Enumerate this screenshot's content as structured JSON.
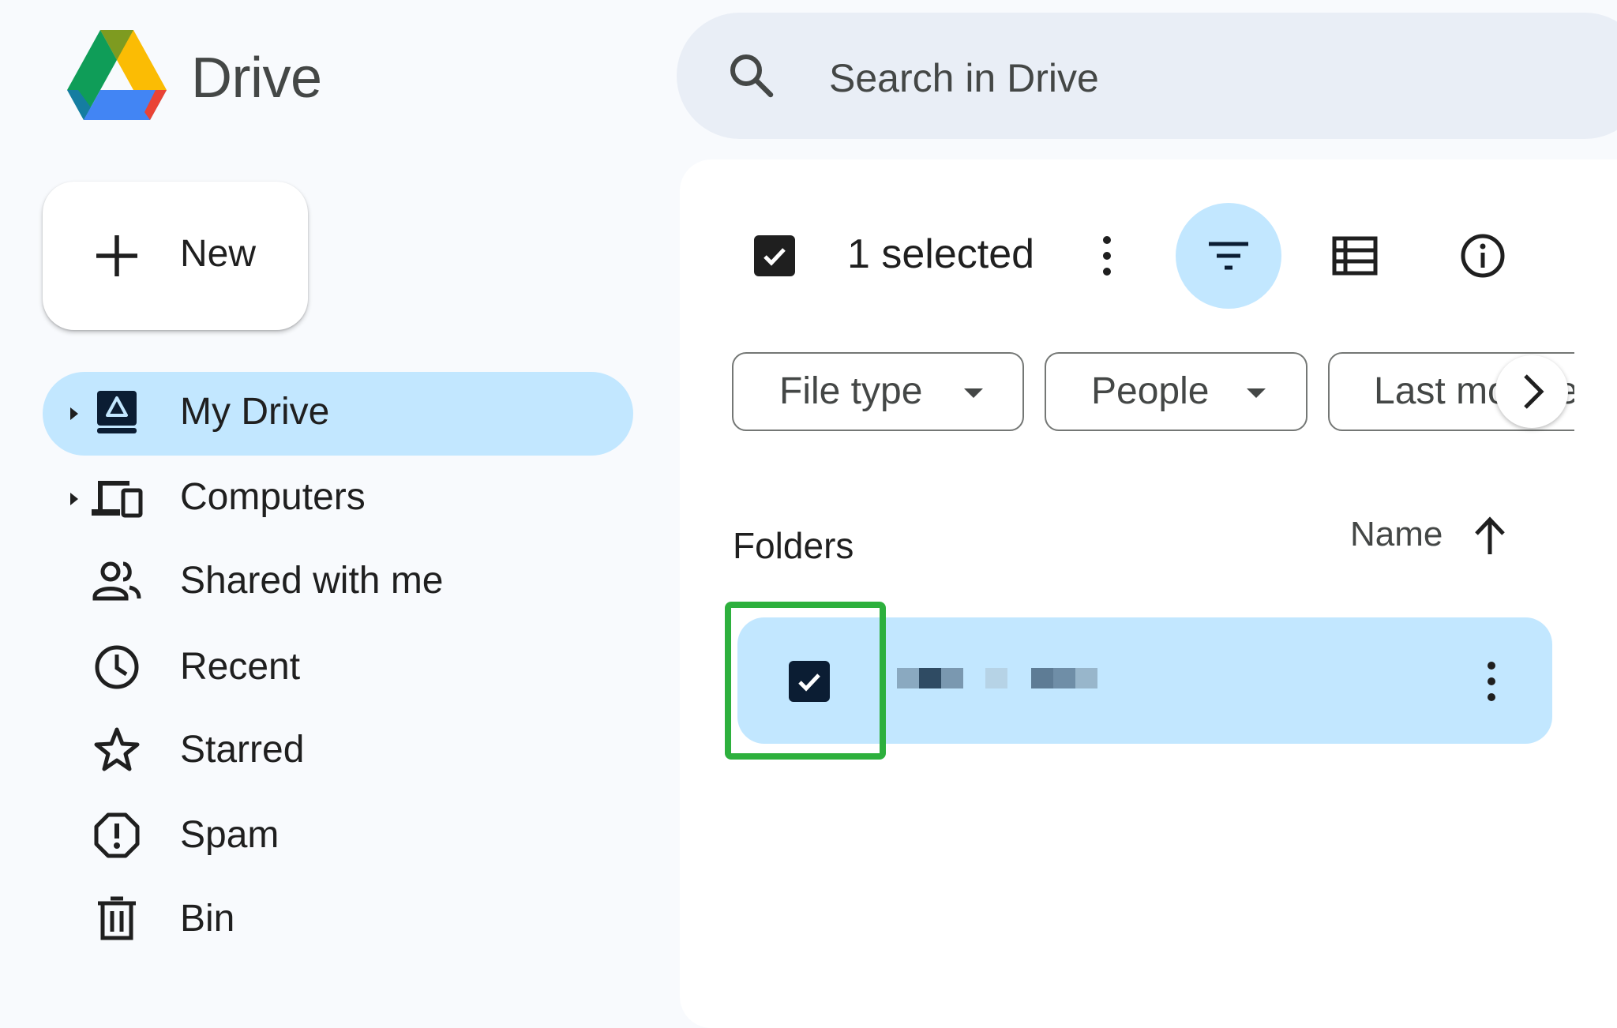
{
  "app": {
    "logo_icon": "google-drive-logo",
    "title": "Drive"
  },
  "search": {
    "placeholder": "Search in Drive",
    "icon": "search-icon"
  },
  "new_button": {
    "label": "New",
    "icon": "plus-icon"
  },
  "sidebar": {
    "items": [
      {
        "label": "My Drive",
        "icon": "my-drive-icon",
        "expandable": true,
        "active": true
      },
      {
        "label": "Computers",
        "icon": "computers-icon",
        "expandable": true,
        "active": false
      },
      {
        "label": "Shared with me",
        "icon": "people-icon",
        "expandable": false,
        "active": false
      },
      {
        "label": "Recent",
        "icon": "clock-icon",
        "expandable": false,
        "active": false
      },
      {
        "label": "Starred",
        "icon": "star-icon",
        "expandable": false,
        "active": false
      },
      {
        "label": "Spam",
        "icon": "spam-icon",
        "expandable": false,
        "active": false
      },
      {
        "label": "Bin",
        "icon": "trash-icon",
        "expandable": false,
        "active": false
      }
    ]
  },
  "selection_toolbar": {
    "count_label": "1 selected",
    "checkbox_checked": true,
    "actions": [
      "more-vert-icon",
      "filter-icon",
      "list-view-icon",
      "info-icon"
    ],
    "filter_active": true
  },
  "filter_chips": [
    {
      "label": "File type",
      "icon": "dropdown-caret-icon"
    },
    {
      "label": "People",
      "icon": "dropdown-caret-icon"
    },
    {
      "label": "Last modified",
      "icon": "dropdown-caret-icon"
    }
  ],
  "chip_scroll": {
    "icon": "chevron-right-icon"
  },
  "folders": {
    "section_title": "Folders",
    "sort_label": "Name",
    "sort_direction": "ascending",
    "rows": [
      {
        "name_redacted": true,
        "selected": true
      }
    ]
  },
  "colors": {
    "page_bg": "#f8fafd",
    "search_bg": "#e9eef6",
    "selected_bg": "#c2e7ff",
    "text": "#1f1f1f",
    "highlight": "#2db03d"
  }
}
